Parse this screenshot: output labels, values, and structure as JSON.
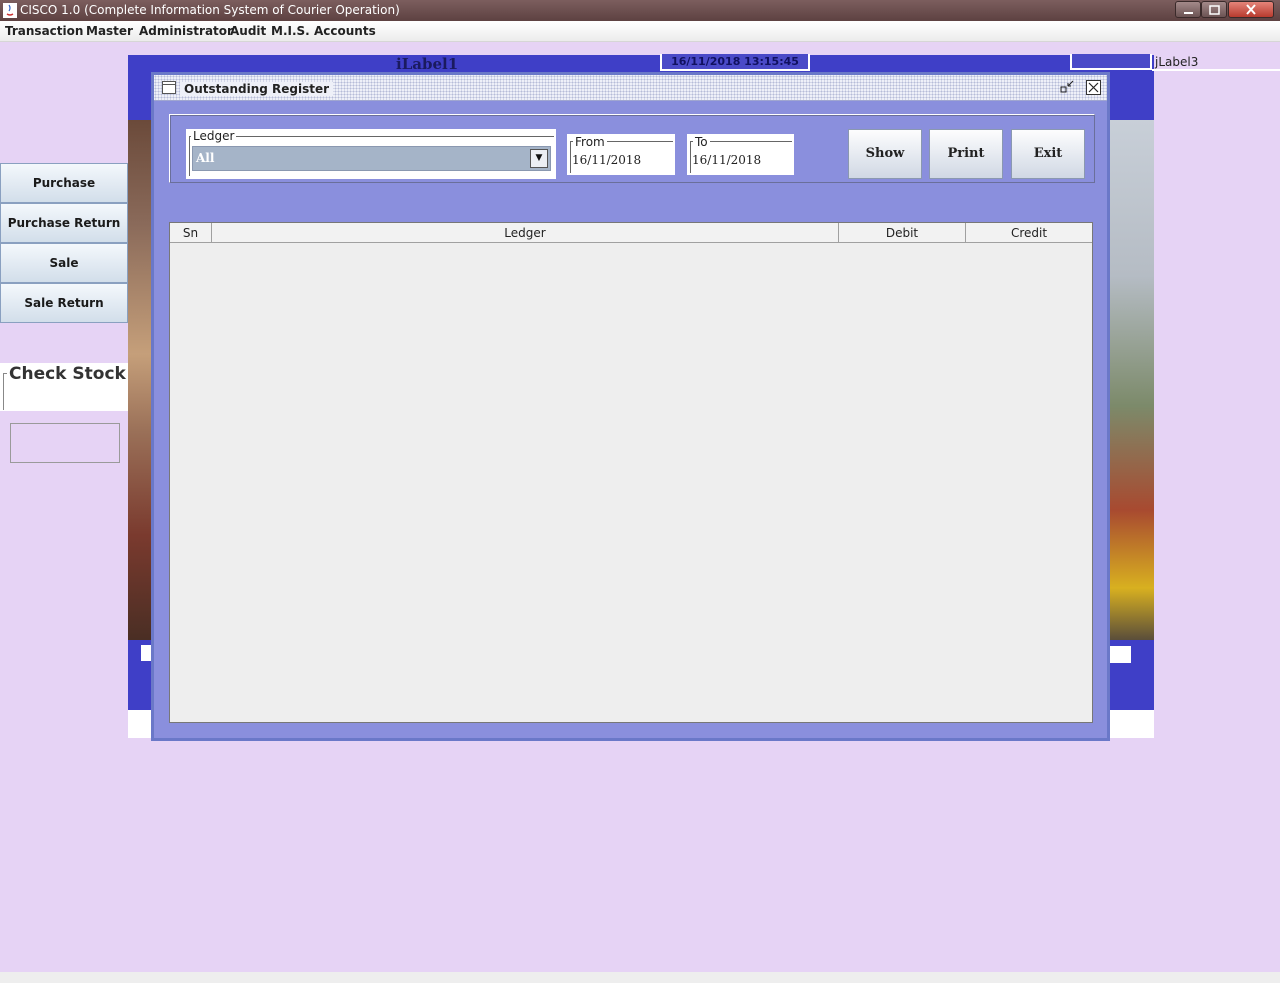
{
  "window": {
    "title": "CISCO 1.0 (Complete Information System of Courier Operation)",
    "controls": {
      "minimize": "–",
      "maximize": "□",
      "close": "✕"
    }
  },
  "menu": [
    "Transaction",
    "Master",
    "Administrator",
    "Audit",
    "M.I.S.",
    "Accounts"
  ],
  "desktop": {
    "ilabel1": "iLabel1",
    "datetime": "16/11/2018    13:15:45",
    "jlabel3": "jLabel3"
  },
  "sidebar": {
    "buttons": [
      "Purchase",
      "Purchase Return",
      "Sale",
      "Sale Return"
    ],
    "check_stock_title": "Check Stock"
  },
  "dialog": {
    "title": "Outstanding Register",
    "ledger_label": "Ledger",
    "ledger_value": "All",
    "from_label": "From",
    "from_value": "16/11/2018",
    "to_label": "To",
    "to_value": "16/11/2018",
    "buttons": {
      "show": "Show",
      "print": "Print",
      "exit": "Exit"
    },
    "table": {
      "columns": [
        "Sn",
        "Ledger",
        "Debit",
        "Credit"
      ],
      "rows": []
    }
  },
  "colors": {
    "desktop_bg": "#e6d3f5",
    "panel_blue": "#3f3fc7",
    "dialog_bg": "#8a8fdd",
    "titlebar": "#5d4141"
  }
}
